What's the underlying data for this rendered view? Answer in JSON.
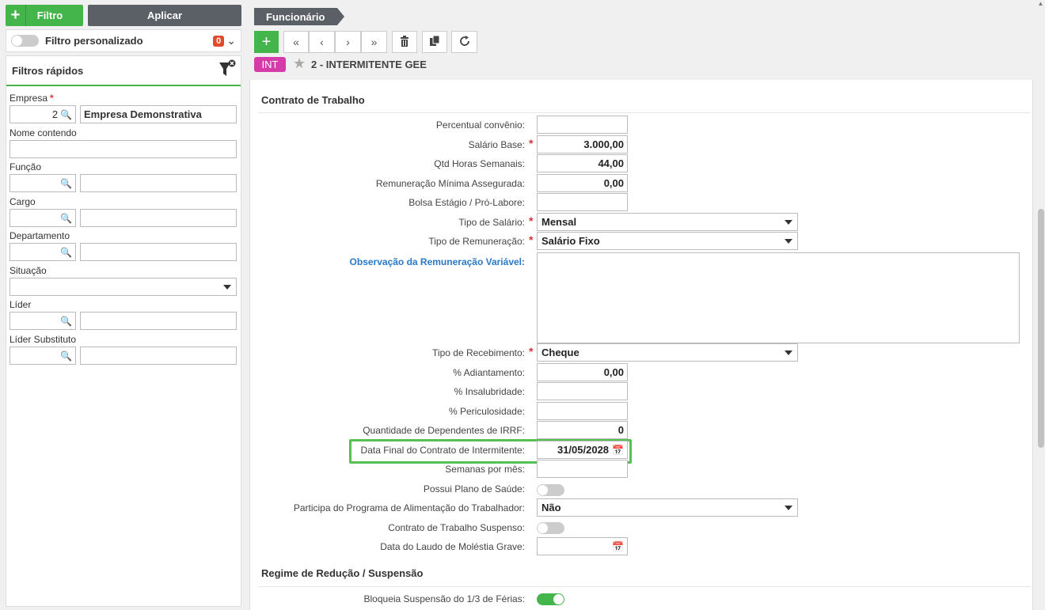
{
  "left": {
    "filtro_label": "Filtro",
    "aplicar_label": "Aplicar",
    "filtro_personalizado": "Filtro personalizado",
    "filtro_count": "0",
    "quick_title": "Filtros rápidos",
    "empresa_label": "Empresa",
    "empresa_code": "2",
    "empresa_name": "Empresa Demonstrativa",
    "nome_label": "Nome contendo",
    "funcao_label": "Função",
    "cargo_label": "Cargo",
    "departamento_label": "Departamento",
    "situacao_label": "Situação",
    "lider_label": "Líder",
    "lider_sub_label": "Líder Substituto"
  },
  "header": {
    "breadcrumb": "Funcionário",
    "badge": "INT",
    "record_title": "2 - INTERMITENTE GEE"
  },
  "form": {
    "section1": "Contrato de Trabalho",
    "section2": "Regime de Redução / Suspensão",
    "percentual_label": "Percentual convênio:",
    "salario_label": "Salário Base:",
    "salario_value": "3.000,00",
    "qtd_label": "Qtd Horas Semanais:",
    "qtd_value": "44,00",
    "remun_label": "Remuneração Mínima Assegurada:",
    "remun_value": "0,00",
    "bolsa_label": "Bolsa Estágio / Pró-Labore:",
    "tipo_salario_label": "Tipo de Salário:",
    "tipo_salario_value": "Mensal",
    "tipo_remun_label": "Tipo de Remuneração:",
    "tipo_remun_value": "Salário Fixo",
    "obs_label": "Observação da Remuneração Variável:",
    "tipo_receb_label": "Tipo de Recebimento:",
    "tipo_receb_value": "Cheque",
    "adiant_label": "% Adiantamento:",
    "adiant_value": "0,00",
    "insal_label": "% Insalubridade:",
    "peric_label": "% Periculosidade:",
    "dep_label": "Quantidade de Dependentes de IRRF:",
    "dep_value": "0",
    "data_final_label": "Data Final do Contrato de Intermitente:",
    "data_final_value": "31/05/2028",
    "semanas_label": "Semanas por mês:",
    "plano_label": "Possui Plano de Saúde:",
    "pat_label": "Participa do Programa de Alimentação do Trabalhador:",
    "pat_value": "Não",
    "suspenso_label": "Contrato de Trabalho Suspenso:",
    "laudo_label": "Data do Laudo de Moléstia Grave:",
    "bloqueia_label": "Bloqueia Suspensão do 1/3 de Férias:"
  },
  "icons": {
    "search": "search-icon",
    "calendar": "calendar-icon",
    "funnel": "funnel-clear-icon"
  },
  "colors": {
    "green": "#43b54a",
    "dark": "#5b5f66",
    "badge_pink": "#d63baa",
    "link_blue": "#2a79c8",
    "required_red": "#d33333",
    "count_red": "#e04a2f"
  }
}
